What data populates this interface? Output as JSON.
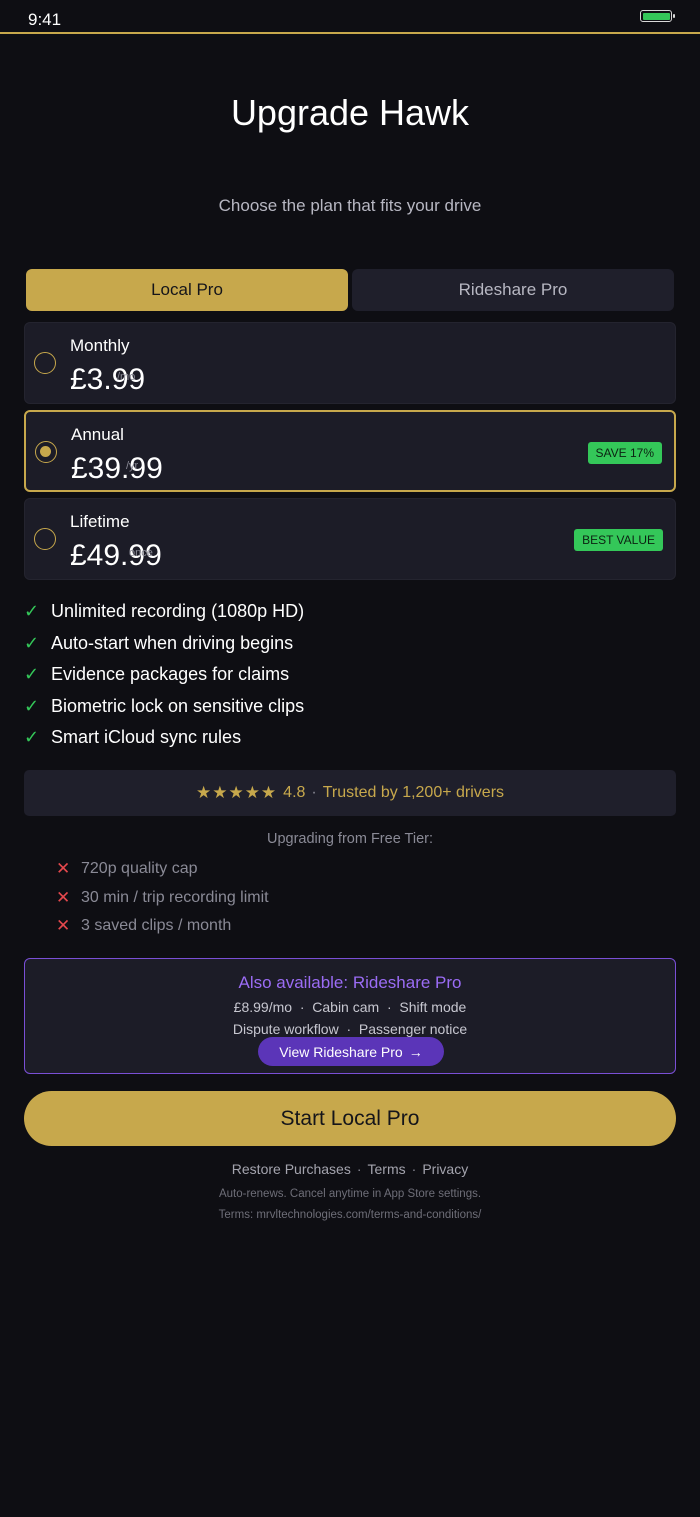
{
  "status_bar": {
    "time": "9:41",
    "battery_color": "#34c759"
  },
  "header": {
    "title": "Upgrade Hawk",
    "subtitle": "Choose the plan that fits your drive"
  },
  "tabs": [
    {
      "label": "Local Pro",
      "active": true
    },
    {
      "label": "Rideshare Pro",
      "active": false
    }
  ],
  "plans": [
    {
      "name": "Monthly",
      "price": "£3.99",
      "suffix": "/mo",
      "selected": false,
      "badge": ""
    },
    {
      "name": "Annual",
      "price": "£39.99",
      "suffix": "/yr",
      "selected": true,
      "badge": "SAVE 17%"
    },
    {
      "name": "Lifetime",
      "price": "£49.99",
      "suffix": "once",
      "selected": false,
      "badge": "BEST VALUE"
    }
  ],
  "features": [
    "Unlimited recording (1080p HD)",
    "Auto-start when driving begins",
    "Evidence packages for claims",
    "Biometric lock on sensitive clips",
    "Smart iCloud sync rules"
  ],
  "rating": {
    "stars": "★★★★★",
    "score": "4.8",
    "separator": "·",
    "text": "Trusted by 1,200+ drivers"
  },
  "upgrade_from": {
    "heading": "Upgrading from Free Tier:",
    "limits": [
      "720p quality cap",
      "30 min / trip recording limit",
      "3 saved clips / month"
    ]
  },
  "rideshare_promo": {
    "title": "Also available: Rideshare Pro",
    "line1": "£8.99/mo  ·  Cabin cam  ·  Shift mode",
    "line2": "Dispute workflow  ·  Passenger notice",
    "button_label": "View Rideshare Pro",
    "button_arrow": "→"
  },
  "cta": {
    "label": "Start Local Pro"
  },
  "footer": {
    "restore": "Restore Purchases",
    "terms": "Terms",
    "privacy": "Privacy",
    "separator": "·",
    "auto_renew": "Auto-renews. Cancel anytime in App Store settings.",
    "terms_url": "Terms: mrvltechnologies.com/terms-and-conditions/"
  },
  "colors": {
    "accent_gold": "#c7a84c",
    "success_green": "#34c759",
    "danger_red": "#e5484d",
    "purple": "#7a4fd6",
    "background": "#0e0e13",
    "card": "#1c1c27"
  }
}
